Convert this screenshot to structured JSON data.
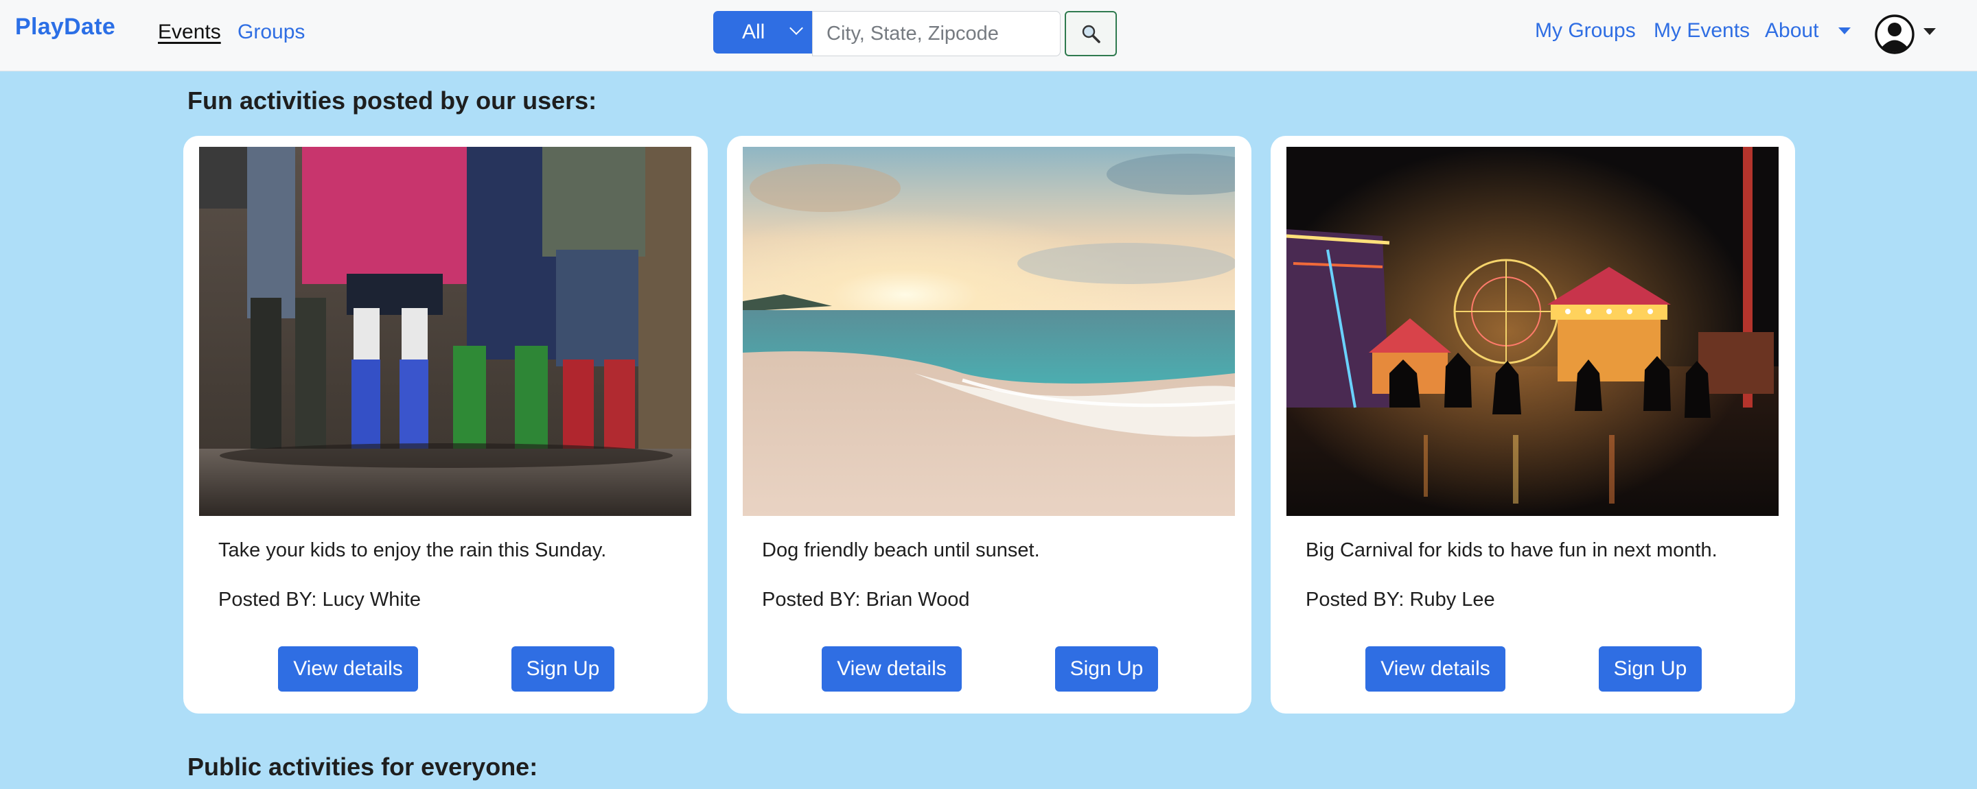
{
  "navbar": {
    "brand": "PlayDate",
    "links": {
      "events": "Events",
      "groups": "Groups",
      "my_groups": "My Groups",
      "my_events": "My Events",
      "about": "About"
    },
    "search": {
      "category_selected": "All",
      "placeholder": "City, State, Zipcode",
      "button_icon": "search-icon"
    },
    "profile_icon": "user-avatar-icon"
  },
  "sections": {
    "fun_title": "Fun activities posted by our users:",
    "public_title": "Public activities for everyone:"
  },
  "cards": [
    {
      "image": "kids-rain-boots-photo",
      "description": "Take your kids to enjoy the rain this Sunday.",
      "posted_by": "Posted BY: Lucy White",
      "details_label": "View details",
      "signup_label": "Sign Up"
    },
    {
      "image": "beach-sunset-photo",
      "description": "Dog friendly beach until sunset.",
      "posted_by": "Posted BY: Brian Wood",
      "details_label": "View details",
      "signup_label": "Sign Up"
    },
    {
      "image": "night-carnival-photo",
      "description": "Big Carnival for kids to have fun in next month.",
      "posted_by": "Posted BY: Ruby Lee",
      "details_label": "View details",
      "signup_label": "Sign Up"
    }
  ],
  "colors": {
    "page_background": "#aedef8",
    "accent": "#2f6ee3",
    "navbar_background": "#f7f8f9"
  }
}
